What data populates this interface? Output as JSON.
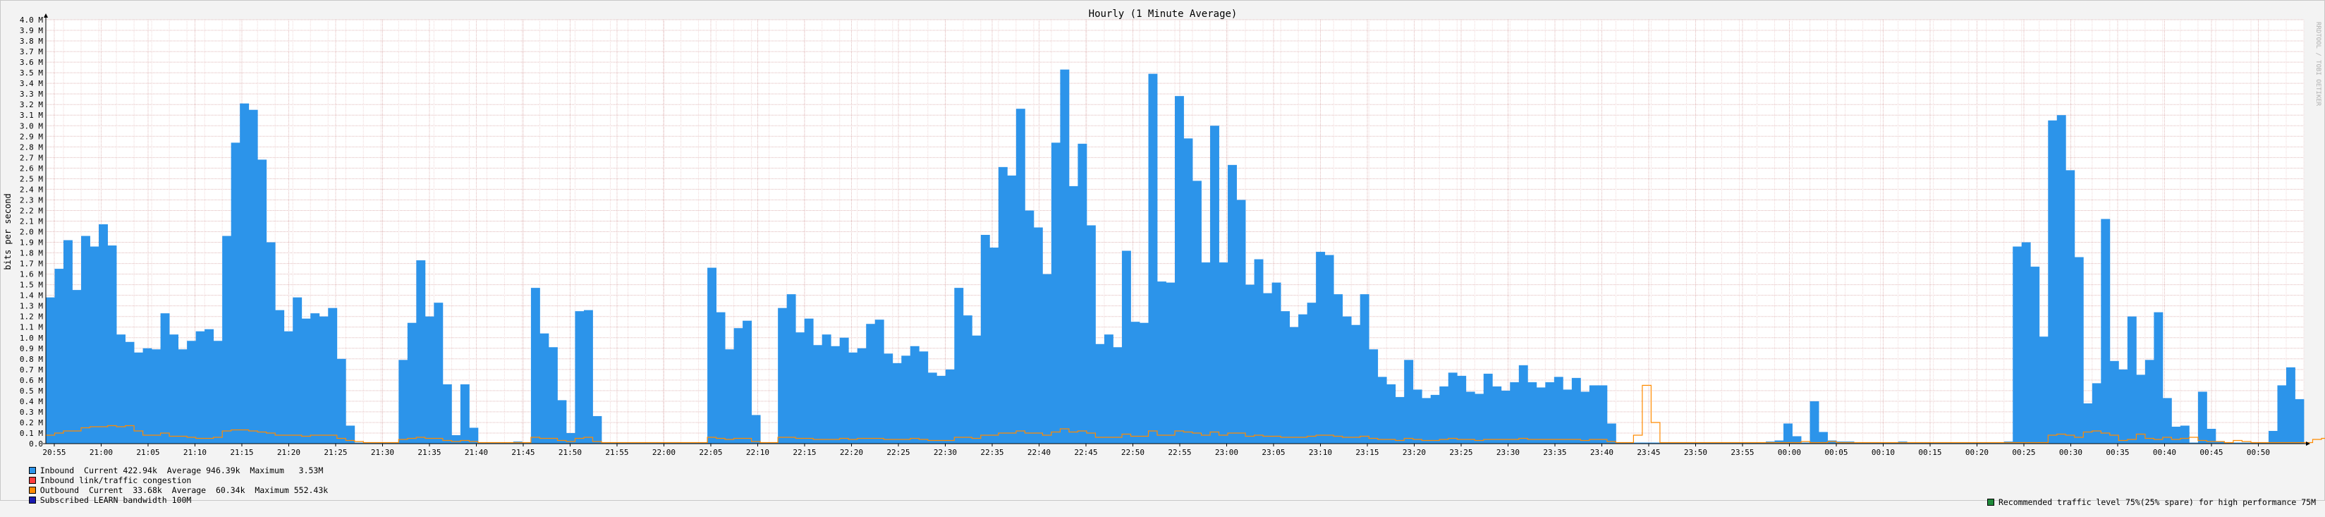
{
  "watermark": "RRDTOOL / TOBI OETIKER",
  "legend": {
    "inbound": "Inbound  Current 422.94k  Average 946.39k  Maximum   3.53M",
    "congestion": "Inbound link/traffic congestion",
    "outbound": "Outbound  Current  33.68k  Average  60.34k  Maximum 552.43k",
    "subscribed": "Subscribed LEARN bandwidth 100M",
    "recommended": "Recommended traffic level 75%(25% spare) for high performance 75M"
  },
  "colors": {
    "inbound": "#2c94ea",
    "congestion": "#ff3c3c",
    "outbound": "#ff8a00",
    "subscribed": "#1a1ab0",
    "recommended": "#1f8a3a",
    "grid_minor": "#f0d8d8",
    "grid_major": "#e0b8b8",
    "plot_bg": "#ffffff"
  },
  "chart_data": {
    "type": "area",
    "title": "Hourly (1 Minute Average)",
    "ylabel": "bits per second",
    "xlabel": "",
    "ylim": [
      0,
      4.0
    ],
    "y_unit": "M",
    "y_ticks": [
      "0.0",
      "0.1 M",
      "0.2 M",
      "0.3 M",
      "0.4 M",
      "0.5 M",
      "0.6 M",
      "0.7 M",
      "0.8 M",
      "0.9 M",
      "1.0 M",
      "1.1 M",
      "1.2 M",
      "1.3 M",
      "1.4 M",
      "1.5 M",
      "1.6 M",
      "1.7 M",
      "1.8 M",
      "1.9 M",
      "2.0 M",
      "2.1 M",
      "2.2 M",
      "2.3 M",
      "2.4 M",
      "2.5 M",
      "2.6 M",
      "2.7 M",
      "2.8 M",
      "2.9 M",
      "3.0 M",
      "3.1 M",
      "3.2 M",
      "3.3 M",
      "3.4 M",
      "3.5 M",
      "3.6 M",
      "3.7 M",
      "3.8 M",
      "3.9 M",
      "4.0 M"
    ],
    "x_ticks": [
      "20:55",
      "21:00",
      "21:05",
      "21:10",
      "21:15",
      "21:20",
      "21:25",
      "21:30",
      "21:35",
      "21:40",
      "21:45",
      "21:50",
      "21:55",
      "22:00",
      "22:05",
      "22:10",
      "22:15",
      "22:20",
      "22:25",
      "22:30",
      "22:35",
      "22:40",
      "22:45",
      "22:50",
      "22:55",
      "23:00",
      "23:05",
      "23:10",
      "23:15",
      "23:20",
      "23:25",
      "23:30",
      "23:35",
      "23:40",
      "23:45",
      "23:50",
      "23:55",
      "00:00",
      "00:05",
      "00:10",
      "00:15",
      "00:20",
      "00:25",
      "00:30",
      "00:35",
      "00:40",
      "00:45",
      "00:50"
    ],
    "grid": true,
    "series": [
      {
        "name": "Inbound",
        "values": [
          1.38,
          1.65,
          1.92,
          1.45,
          1.96,
          1.86,
          2.07,
          1.87,
          1.03,
          0.96,
          0.86,
          0.9,
          0.89,
          1.23,
          1.03,
          0.89,
          0.97,
          1.06,
          1.08,
          0.97,
          1.96,
          2.84,
          3.21,
          3.15,
          2.68,
          1.9,
          1.26,
          1.06,
          1.38,
          1.18,
          1.23,
          1.2,
          1.28,
          0.8,
          0.17,
          0.01,
          0.01,
          0.01,
          0.01,
          0.01,
          0.79,
          1.14,
          1.73,
          1.2,
          1.33,
          0.56,
          0.08,
          0.56,
          0.15,
          0.01,
          0.01,
          0.01,
          0.01,
          0.02,
          0.01,
          1.47,
          1.04,
          0.91,
          0.41,
          0.1,
          1.25,
          1.26,
          0.26,
          0.01,
          0.01,
          0.01,
          0.01,
          0.01,
          0.01,
          0.01,
          0.01,
          0.01,
          0.01,
          0.01,
          0.01,
          1.66,
          1.24,
          0.89,
          1.09,
          1.16,
          0.27,
          0.01,
          0.01,
          1.28,
          1.41,
          1.05,
          1.18,
          0.93,
          1.03,
          0.92,
          1.0,
          0.86,
          0.9,
          1.13,
          1.17,
          0.85,
          0.76,
          0.83,
          0.92,
          0.87,
          0.67,
          0.64,
          0.7,
          1.47,
          1.21,
          1.02,
          1.97,
          1.85,
          2.61,
          2.53,
          3.16,
          2.2,
          2.04,
          1.6,
          2.84,
          3.53,
          2.43,
          2.83,
          2.06,
          0.94,
          1.03,
          0.91,
          1.82,
          1.15,
          1.14,
          3.49,
          1.53,
          1.52,
          3.28,
          2.88,
          2.48,
          1.71,
          3.0,
          1.71,
          2.63,
          2.3,
          1.5,
          1.74,
          1.42,
          1.52,
          1.25,
          1.1,
          1.22,
          1.33,
          1.81,
          1.78,
          1.41,
          1.2,
          1.12,
          1.41,
          0.89,
          0.63,
          0.56,
          0.44,
          0.79,
          0.51,
          0.43,
          0.46,
          0.54,
          0.67,
          0.64,
          0.49,
          0.47,
          0.66,
          0.54,
          0.5,
          0.58,
          0.74,
          0.58,
          0.53,
          0.58,
          0.63,
          0.51,
          0.62,
          0.49,
          0.55,
          0.55,
          0.19,
          0.01,
          0.01,
          0.01,
          0.01,
          0.01,
          0.01,
          0.01,
          0.01,
          0.01,
          0.01,
          0.01,
          0.01,
          0.01,
          0.01,
          0.01,
          0.01,
          0.01,
          0.02,
          0.03,
          0.19,
          0.07,
          0.01,
          0.4,
          0.11,
          0.03,
          0.02,
          0.02,
          0.01,
          0.01,
          0.01,
          0.01,
          0.01,
          0.02,
          0.01,
          0.01,
          0.01,
          0.01,
          0.01,
          0.01,
          0.01,
          0.01,
          0.01,
          0.01,
          0.01,
          0.02,
          1.86,
          1.9,
          1.67,
          1.01,
          3.05,
          3.1,
          2.58,
          1.76,
          0.38,
          0.57,
          2.12,
          0.78,
          0.7,
          1.2,
          0.65,
          0.79,
          1.24,
          0.43,
          0.16,
          0.17,
          0.01,
          0.49,
          0.14,
          0.02,
          0.01,
          0.01,
          0.01,
          0.01,
          0.01,
          0.12,
          0.55,
          0.72,
          0.42
        ]
      },
      {
        "name": "Outbound",
        "values": [
          0.08,
          0.1,
          0.12,
          0.12,
          0.15,
          0.16,
          0.16,
          0.17,
          0.16,
          0.17,
          0.12,
          0.08,
          0.08,
          0.1,
          0.07,
          0.07,
          0.06,
          0.05,
          0.05,
          0.06,
          0.12,
          0.13,
          0.13,
          0.12,
          0.11,
          0.1,
          0.08,
          0.08,
          0.08,
          0.07,
          0.08,
          0.08,
          0.08,
          0.05,
          0.03,
          0.02,
          0.01,
          0.01,
          0.01,
          0.01,
          0.04,
          0.05,
          0.06,
          0.05,
          0.05,
          0.03,
          0.02,
          0.03,
          0.02,
          0.01,
          0.01,
          0.01,
          0.01,
          0.01,
          0.01,
          0.06,
          0.05,
          0.05,
          0.03,
          0.02,
          0.05,
          0.06,
          0.02,
          0.01,
          0.01,
          0.01,
          0.01,
          0.01,
          0.01,
          0.01,
          0.01,
          0.01,
          0.01,
          0.01,
          0.01,
          0.06,
          0.05,
          0.04,
          0.05,
          0.05,
          0.02,
          0.01,
          0.01,
          0.06,
          0.06,
          0.05,
          0.05,
          0.04,
          0.04,
          0.04,
          0.05,
          0.04,
          0.05,
          0.05,
          0.05,
          0.04,
          0.04,
          0.04,
          0.05,
          0.04,
          0.03,
          0.03,
          0.03,
          0.06,
          0.06,
          0.05,
          0.08,
          0.08,
          0.1,
          0.1,
          0.12,
          0.1,
          0.1,
          0.08,
          0.11,
          0.14,
          0.11,
          0.12,
          0.1,
          0.06,
          0.06,
          0.06,
          0.09,
          0.07,
          0.07,
          0.12,
          0.08,
          0.08,
          0.12,
          0.11,
          0.1,
          0.08,
          0.11,
          0.08,
          0.1,
          0.1,
          0.07,
          0.08,
          0.07,
          0.07,
          0.06,
          0.06,
          0.06,
          0.07,
          0.08,
          0.08,
          0.07,
          0.06,
          0.06,
          0.07,
          0.05,
          0.04,
          0.04,
          0.03,
          0.05,
          0.04,
          0.03,
          0.03,
          0.04,
          0.05,
          0.04,
          0.04,
          0.03,
          0.04,
          0.04,
          0.04,
          0.04,
          0.05,
          0.04,
          0.04,
          0.04,
          0.04,
          0.04,
          0.04,
          0.03,
          0.04,
          0.04,
          0.02,
          0.01,
          0.01,
          0.08,
          0.55,
          0.2,
          0.01,
          0.01,
          0.01,
          0.01,
          0.01,
          0.01,
          0.01,
          0.01,
          0.01,
          0.01,
          0.01,
          0.01,
          0.01,
          0.01,
          0.01,
          0.01,
          0.02,
          0.01,
          0.01,
          0.02,
          0.01,
          0.01,
          0.01,
          0.01,
          0.01,
          0.01,
          0.01,
          0.01,
          0.01,
          0.01,
          0.01,
          0.01,
          0.01,
          0.01,
          0.01,
          0.01,
          0.01,
          0.01,
          0.01,
          0.01,
          0.01,
          0.01,
          0.01,
          0.01,
          0.08,
          0.09,
          0.08,
          0.06,
          0.11,
          0.12,
          0.1,
          0.08,
          0.03,
          0.04,
          0.09,
          0.05,
          0.04,
          0.06,
          0.04,
          0.05,
          0.06,
          0.03,
          0.02,
          0.02,
          0.01,
          0.03,
          0.02,
          0.01,
          0.01,
          0.01,
          0.01,
          0.01,
          0.01,
          0.01,
          0.04,
          0.05,
          0.03
        ]
      }
    ]
  }
}
